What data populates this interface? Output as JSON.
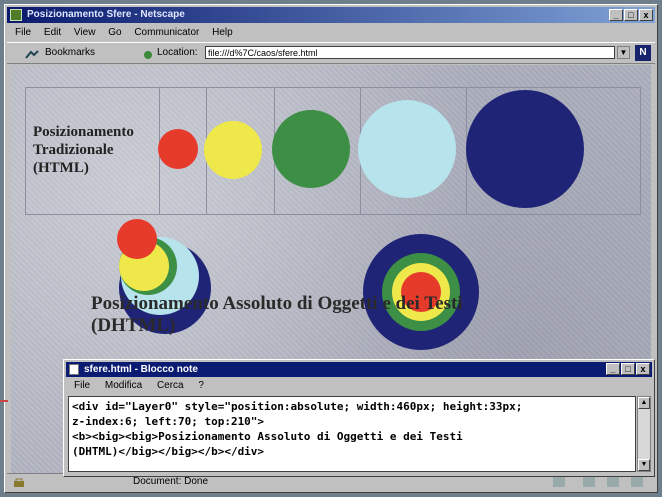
{
  "window": {
    "title": "Posizionamento Sfere - Netscape"
  },
  "menu": {
    "items": [
      "File",
      "Edit",
      "View",
      "Go",
      "Communicator",
      "Help"
    ]
  },
  "toolbar": {
    "bookmarks_label": "Bookmarks",
    "location_label": "Location:",
    "location_url": "file:///d%7C/caos/sfere.html",
    "logo_letter": "N"
  },
  "page": {
    "traditional_label": "Posizionamento Tradizionale (HTML)",
    "absolute_label": "Posizionamento Assoluto di Oggetti e dei Testi (DHTML)"
  },
  "colors": {
    "red": "#e63a2a",
    "yellow": "#efe84a",
    "green": "#3c8f45",
    "lightblue": "#b6e3ec",
    "navy": "#1f2477"
  },
  "notepad": {
    "title": "sfere.html - Blocco note",
    "menu": [
      "File",
      "Modifica",
      "Cerca",
      "?"
    ],
    "text_lines": [
      "<div id=\"Layer0\" style=\"position:absolute; width:460px; height:33px;",
      "z-index:6; left:70; top:210\">",
      "<b><big><big>Posizionamento Assoluto di Oggetti e dei Testi",
      "(DHTML)</big></big></b></div>"
    ]
  },
  "status": {
    "message": "Document: Done"
  }
}
